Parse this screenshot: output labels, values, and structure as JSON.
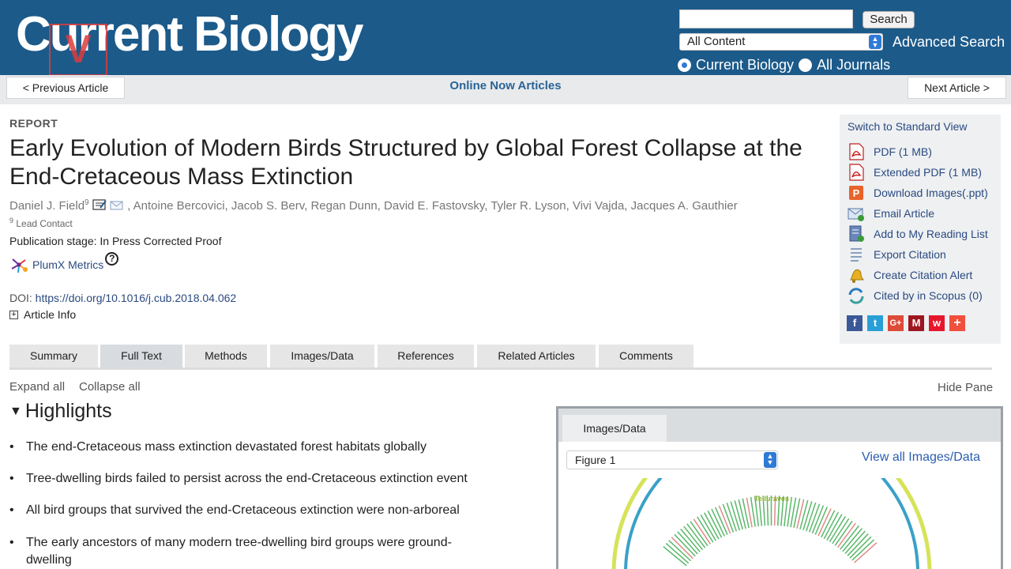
{
  "header": {
    "logo_text": "Current Biology",
    "watermark_text": "V",
    "search_button": "Search",
    "content_select": "All Content",
    "advanced_search": "Advanced Search",
    "scope_options": [
      {
        "label": "Current Biology",
        "selected": true
      },
      {
        "label": "All Journals",
        "selected": false
      }
    ],
    "colors": {
      "header_bg": "#1c5a8a",
      "link": "#2a4a80"
    }
  },
  "nav": {
    "previous": "< Previous Article",
    "center": "Online Now Articles",
    "next": "Next Article >"
  },
  "article": {
    "type": "REPORT",
    "title": "Early Evolution of Modern Birds Structured by Global Forest Collapse at the End-Cretaceous Mass Extinction",
    "first_author": "Daniel J. Field",
    "first_author_sup": "9",
    "other_authors": ", Antoine Bercovici, Jacob S. Berv, Regan Dunn, David E. Fastovsky, Tyler R. Lyson, Vivi Vajda, Jacques A. Gauthier",
    "lead_contact_sup": "9",
    "lead_contact": "Lead Contact",
    "publication_stage": "Publication stage: In Press Corrected Proof",
    "plumx": "PlumX Metrics",
    "doi_label": "DOI:",
    "doi": "https://doi.org/10.1016/j.cub.2018.04.062",
    "article_info": "Article Info"
  },
  "sidebar": {
    "switch_view": "Switch to Standard View",
    "items": [
      {
        "label": "PDF (1 MB)",
        "icon": "pdf-icon"
      },
      {
        "label": "Extended PDF (1 MB)",
        "icon": "pdf-icon"
      },
      {
        "label": "Download Images(.ppt)",
        "icon": "ppt-icon"
      },
      {
        "label": "Email Article",
        "icon": "email-icon"
      },
      {
        "label": "Add to My Reading List",
        "icon": "reading-list-icon"
      },
      {
        "label": "Export Citation",
        "icon": "export-citation-icon"
      },
      {
        "label": "Create Citation Alert",
        "icon": "bell-icon"
      },
      {
        "label": "Cited by in Scopus (0)",
        "icon": "scopus-icon"
      }
    ],
    "social": [
      {
        "name": "facebook",
        "glyph": "f",
        "color": "#3b5998"
      },
      {
        "name": "twitter",
        "glyph": "t",
        "color": "#2a9fd6"
      },
      {
        "name": "google-plus",
        "glyph": "G+",
        "color": "#dd4b39"
      },
      {
        "name": "mendeley",
        "glyph": "M",
        "color": "#9d1620"
      },
      {
        "name": "weibo",
        "glyph": "w",
        "color": "#e6162d"
      },
      {
        "name": "more",
        "glyph": "+",
        "color": "#f0503c"
      }
    ]
  },
  "tabs": [
    "Summary",
    "Full Text",
    "Methods",
    "Images/Data",
    "References",
    "Related Articles",
    "Comments"
  ],
  "active_tab": "Full Text",
  "body": {
    "expand_all": "Expand all",
    "collapse_all": "Collapse all",
    "hide_pane": "Hide Pane",
    "highlights_heading": "Highlights",
    "highlights": [
      "The end-Cretaceous mass extinction devastated forest habitats globally",
      "Tree-dwelling birds failed to persist across the end-Cretaceous extinction event",
      "All bird groups that survived the end-Cretaceous extinction were non-arboreal",
      "The early ancestors of many modern tree-dwelling bird groups were ground-dwelling"
    ]
  },
  "figure_pane": {
    "tab": "Images/Data",
    "figure_select": "Figure 1",
    "view_all": "View all Images/Data",
    "figure_label": "Telluraves"
  }
}
